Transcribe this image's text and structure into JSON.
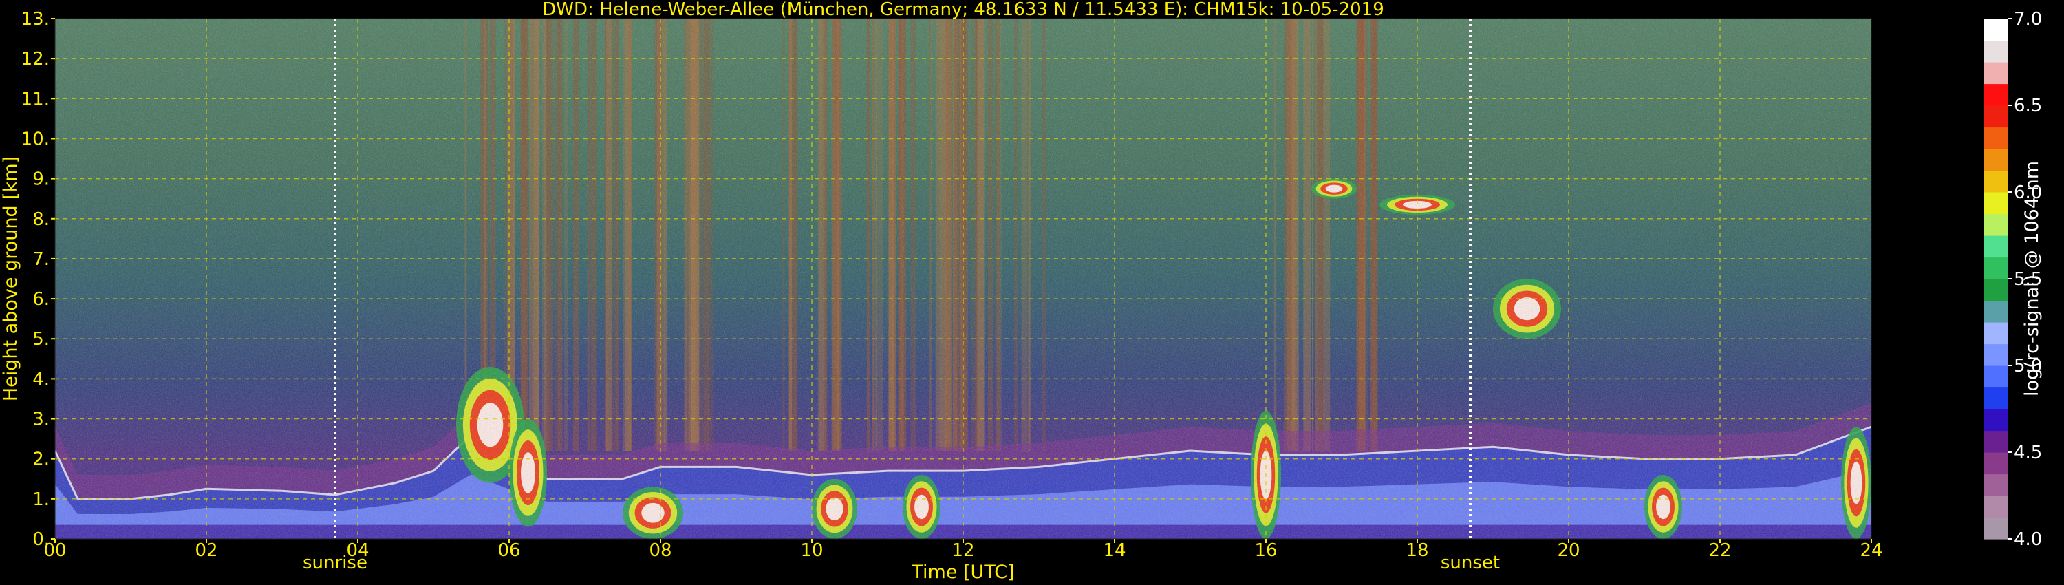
{
  "chart_data": {
    "type": "heatmap",
    "title": "DWD: Helene-Weber-Allee (München, Germany; 48.1633 N / 11.5433 E):    CHM15k: 10-05-2019",
    "xlabel": "Time [UTC]",
    "ylabel": "Height above ground [km]",
    "xlim": [
      0,
      24
    ],
    "ylim": [
      0,
      13
    ],
    "x_ticks": [
      {
        "value": 0,
        "label": "00"
      },
      {
        "value": 2,
        "label": "02"
      },
      {
        "value": 4,
        "label": "04"
      },
      {
        "value": 6,
        "label": "06"
      },
      {
        "value": 8,
        "label": "08"
      },
      {
        "value": 10,
        "label": "10"
      },
      {
        "value": 12,
        "label": "12"
      },
      {
        "value": 14,
        "label": "14"
      },
      {
        "value": 16,
        "label": "16"
      },
      {
        "value": 18,
        "label": "18"
      },
      {
        "value": 20,
        "label": "20"
      },
      {
        "value": 22,
        "label": "22"
      },
      {
        "value": 24,
        "label": "24"
      }
    ],
    "y_ticks": [
      {
        "value": 0,
        "label": "0."
      },
      {
        "value": 1,
        "label": "1."
      },
      {
        "value": 2,
        "label": "2."
      },
      {
        "value": 3,
        "label": "3."
      },
      {
        "value": 4,
        "label": "4."
      },
      {
        "value": 5,
        "label": "5."
      },
      {
        "value": 6,
        "label": "6."
      },
      {
        "value": 7,
        "label": "7."
      },
      {
        "value": 8,
        "label": "8."
      },
      {
        "value": 9,
        "label": "9."
      },
      {
        "value": 10,
        "label": "10."
      },
      {
        "value": 11,
        "label": "11."
      },
      {
        "value": 12,
        "label": "12."
      },
      {
        "value": 13,
        "label": "13."
      }
    ],
    "grid": true,
    "annotations": [
      {
        "x": 3.7,
        "label": "sunrise"
      },
      {
        "x": 18.7,
        "label": "sunset"
      }
    ],
    "colorbar": {
      "label": "log(rc-signal) @ 1064 nm",
      "range": [
        4.0,
        7.0
      ],
      "ticks": [
        {
          "value": 4.0,
          "label": "4.0"
        },
        {
          "value": 4.5,
          "label": "4.5"
        },
        {
          "value": 5.0,
          "label": "5.0"
        },
        {
          "value": 5.5,
          "label": "5.5"
        },
        {
          "value": 6.0,
          "label": "6.0"
        },
        {
          "value": 6.5,
          "label": "6.5"
        },
        {
          "value": 7.0,
          "label": "7.0"
        }
      ],
      "colors": [
        "#a897a8",
        "#b08aa8",
        "#a06098",
        "#8a3a8a",
        "#6a2090",
        "#3010c0",
        "#2040f0",
        "#5070ff",
        "#7a95ff",
        "#a0b4ff",
        "#5aa0a8",
        "#20a040",
        "#30c060",
        "#50e090",
        "#b8f060",
        "#e8f020",
        "#f0c010",
        "#f09010",
        "#f06010",
        "#f02010",
        "#ff1010",
        "#f0b0b0",
        "#e8e0e0",
        "#ffffff"
      ]
    },
    "color_scheme": {
      "background": "#000000",
      "text": "#ffee00",
      "grid": "#d8d000",
      "markers": "#ffffff"
    },
    "features": {
      "boundary_layer_top": [
        [
          0.0,
          2.2
        ],
        [
          0.3,
          1.0
        ],
        [
          1.0,
          1.0
        ],
        [
          1.5,
          1.1
        ],
        [
          2.0,
          1.25
        ],
        [
          3.0,
          1.2
        ],
        [
          3.7,
          1.1
        ],
        [
          4.5,
          1.4
        ],
        [
          5.0,
          1.7
        ],
        [
          5.5,
          2.6
        ],
        [
          6.0,
          2.0
        ],
        [
          6.5,
          1.5
        ],
        [
          7.0,
          1.5
        ],
        [
          7.5,
          1.5
        ],
        [
          8.0,
          1.8
        ],
        [
          9.0,
          1.8
        ],
        [
          10.0,
          1.6
        ],
        [
          11.0,
          1.7
        ],
        [
          12.0,
          1.7
        ],
        [
          13.0,
          1.8
        ],
        [
          14.0,
          2.0
        ],
        [
          15.0,
          2.2
        ],
        [
          16.0,
          2.1
        ],
        [
          17.0,
          2.1
        ],
        [
          18.0,
          2.2
        ],
        [
          19.0,
          2.3
        ],
        [
          20.0,
          2.1
        ],
        [
          21.0,
          2.0
        ],
        [
          22.0,
          2.0
        ],
        [
          23.0,
          2.1
        ],
        [
          24.0,
          2.8
        ]
      ],
      "cloud_layers": [
        {
          "t0": 5.3,
          "t1": 6.2,
          "h0": 1.4,
          "h1": 4.3
        },
        {
          "t0": 6.0,
          "t1": 6.5,
          "h0": 0.3,
          "h1": 3.0
        },
        {
          "t0": 7.5,
          "t1": 8.3,
          "h0": 0.0,
          "h1": 1.3
        },
        {
          "t0": 10.0,
          "t1": 10.6,
          "h0": 0.0,
          "h1": 1.5
        },
        {
          "t0": 11.2,
          "t1": 11.7,
          "h0": 0.0,
          "h1": 1.6
        },
        {
          "t0": 15.8,
          "t1": 16.2,
          "h0": 0.0,
          "h1": 3.2
        },
        {
          "t0": 16.6,
          "t1": 17.2,
          "h0": 8.5,
          "h1": 9.0
        },
        {
          "t0": 17.5,
          "t1": 18.5,
          "h0": 8.1,
          "h1": 8.6
        },
        {
          "t0": 19.0,
          "t1": 19.9,
          "h0": 5.0,
          "h1": 6.5
        },
        {
          "t0": 21.0,
          "t1": 21.5,
          "h0": 0.0,
          "h1": 1.6
        },
        {
          "t0": 23.6,
          "t1": 24.0,
          "h0": 0.0,
          "h1": 2.8
        }
      ]
    }
  }
}
